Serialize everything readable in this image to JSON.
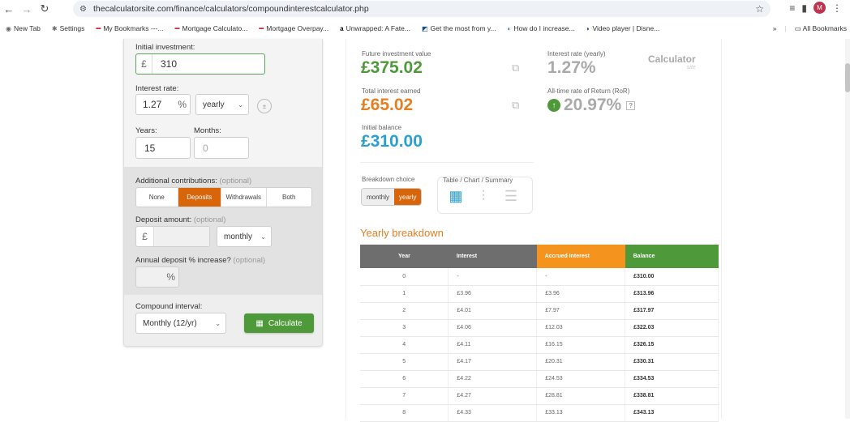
{
  "browser": {
    "url": "thecalculatorsite.com/finance/calculators/compoundinterestcalculator.php",
    "bookmarks": [
      "New Tab",
      "Settings",
      "My Bookmarks ---...",
      "Mortgage Calculato...",
      "Mortgage Overpay...",
      "Unwrapped: A Fate...",
      "Get the most from y...",
      "How do I increase...",
      "Video player | Disne..."
    ],
    "all_bookmarks": "All Bookmarks",
    "more": "»",
    "profile_initial": "M"
  },
  "form": {
    "initial_investment_label": "Initial investment:",
    "currency_symbol": "£",
    "initial_investment_value": "310",
    "interest_rate_label": "Interest rate:",
    "interest_rate_value": "1.27",
    "percent_symbol": "%",
    "rate_period": "yearly",
    "years_label": "Years:",
    "months_label": "Months:",
    "years_value": "15",
    "months_placeholder": "0",
    "additional_contributions_label": "Additional contributions:",
    "optional": "(optional)",
    "contribution_options": [
      "None",
      "Deposits",
      "Withdrawals",
      "Both"
    ],
    "selected_contribution": "Deposits",
    "deposit_amount_label": "Deposit amount:",
    "deposit_frequency": "monthly",
    "annual_increase_label": "Annual deposit % increase?",
    "compound_interval_label": "Compound interval:",
    "compound_interval_value": "Monthly (12/yr)",
    "calculate_label": "Calculate"
  },
  "results": {
    "future_value_label": "Future investment value",
    "future_value": "£375.02",
    "interest_rate_yearly_label": "Interest rate (yearly)",
    "interest_rate_yearly": "1.27%",
    "total_interest_label": "Total interest earned",
    "total_interest": "£65.02",
    "ror_label": "All-time rate of Return (RoR)",
    "ror_value": "20.97%",
    "question": "?",
    "initial_balance_label": "Initial balance",
    "initial_balance": "£310.00",
    "logo_text": "Calculator",
    "logo_sub": "site"
  },
  "breakdown": {
    "choice_label": "Breakdown choice",
    "choices": [
      "monthly",
      "yearly"
    ],
    "selected": "yearly",
    "view_label": "Table / Chart / Summary",
    "title": "Yearly breakdown",
    "headers": [
      "Year",
      "Interest",
      "Accrued Interest",
      "Balance"
    ],
    "rows": [
      [
        "0",
        "-",
        "-",
        "£310.00"
      ],
      [
        "1",
        "£3.96",
        "£3.96",
        "£313.96"
      ],
      [
        "2",
        "£4.01",
        "£7.97",
        "£317.97"
      ],
      [
        "3",
        "£4.06",
        "£12.03",
        "£322.03"
      ],
      [
        "4",
        "£4.11",
        "£16.15",
        "£326.15"
      ],
      [
        "5",
        "£4.17",
        "£20.31",
        "£330.31"
      ],
      [
        "6",
        "£4.22",
        "£24.53",
        "£334.53"
      ],
      [
        "7",
        "£4.27",
        "£28.81",
        "£338.81"
      ],
      [
        "8",
        "£4.33",
        "£33.13",
        "£343.13"
      ]
    ]
  },
  "colors": {
    "accent_orange": "#d9650a",
    "green": "#4e9a3a",
    "blue": "#2a9fd6"
  }
}
